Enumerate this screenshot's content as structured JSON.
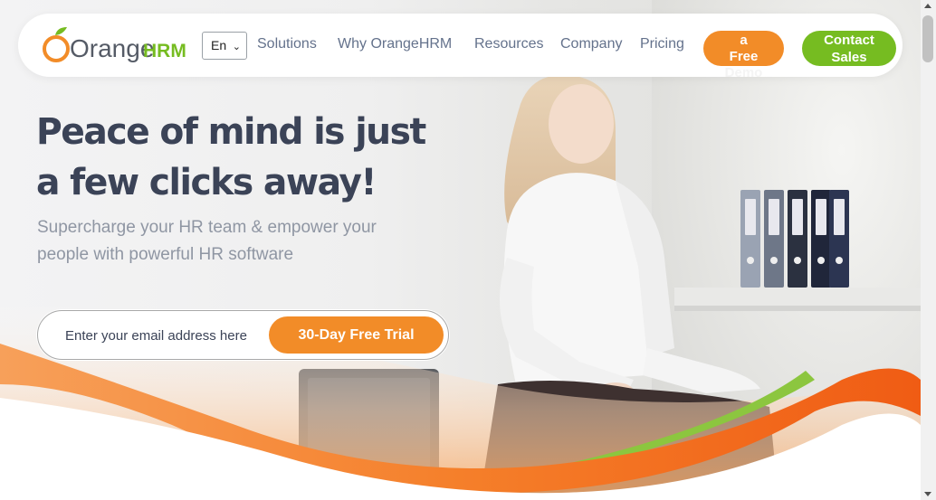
{
  "brand": {
    "logo_text_orange": "Orange",
    "logo_text_hrm": "HRM",
    "colors": {
      "orange": "#f28c28",
      "green": "#76bc21",
      "navy": "#3b4357",
      "gray_text": "#8f96a3"
    }
  },
  "nav": {
    "language": "En",
    "links": [
      "Solutions",
      "Why OrangeHRM",
      "Resources",
      "Company",
      "Pricing"
    ],
    "demo_button": {
      "line1": "a",
      "line2": "Free",
      "line3": "Demo"
    },
    "sales_button": {
      "line1": "Contact",
      "line2": "Sales"
    }
  },
  "hero": {
    "headline_line1": "Peace of mind is just",
    "headline_line2": "a few clicks away!",
    "subtitle_line1": "Supercharge your HR team & empower your",
    "subtitle_line2": "people with powerful HR software",
    "email_placeholder": "Enter your email address here",
    "cta_label": "30-Day Free Trial"
  },
  "icons": {
    "language_dropdown": "chevron-down-icon",
    "scrollbar": [
      "scroll-up-arrow-icon",
      "scroll-down-arrow-icon"
    ]
  }
}
